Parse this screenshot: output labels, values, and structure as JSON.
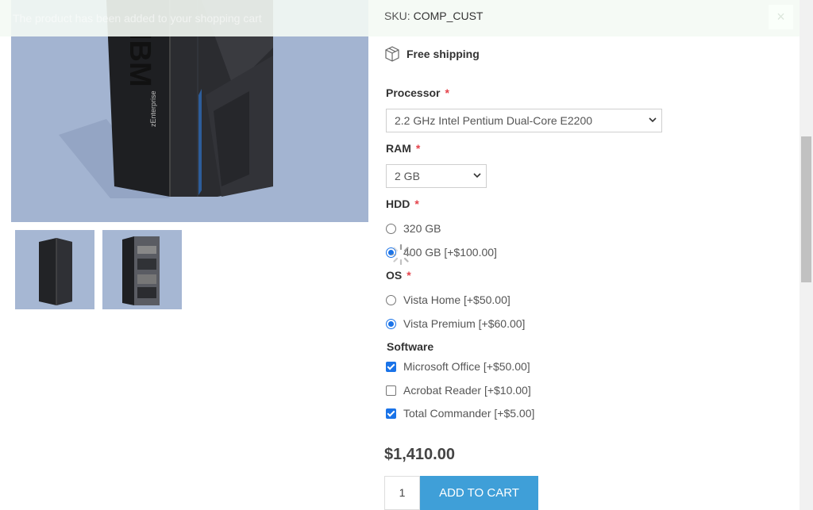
{
  "notification": {
    "text": "The product has been added to your shopping cart",
    "close_glyph": "×"
  },
  "product": {
    "sku_label": "SKU:",
    "sku_value": "COMP_CUST",
    "shipping_label": "Free shipping",
    "main_image_brand": "IBM",
    "main_image_caption": "zEnterprise"
  },
  "attributes": {
    "processor": {
      "label": "Processor",
      "required": "*",
      "selected": "2.2 GHz Intel Pentium Dual-Core E2200"
    },
    "ram": {
      "label": "RAM",
      "required": "*",
      "selected": "2 GB"
    },
    "hdd": {
      "label": "HDD",
      "required": "*",
      "options": [
        {
          "label": "320 GB",
          "checked": false
        },
        {
          "label": "400 GB [+$100.00]",
          "checked": true
        }
      ]
    },
    "os": {
      "label": "OS",
      "required": "*",
      "options": [
        {
          "label": "Vista Home [+$50.00]",
          "checked": false
        },
        {
          "label": "Vista Premium [+$60.00]",
          "checked": true
        }
      ]
    },
    "software": {
      "label": "Software",
      "options": [
        {
          "label": "Microsoft Office [+$50.00]",
          "checked": true
        },
        {
          "label": "Acrobat Reader [+$10.00]",
          "checked": false
        },
        {
          "label": "Total Commander [+$5.00]",
          "checked": true
        }
      ]
    }
  },
  "price": "$1,410.00",
  "quantity": "1",
  "add_to_cart_label": "ADD TO CART",
  "colors": {
    "accent": "#3f9fd8",
    "required": "#e4434b",
    "image_bg": "#a3b4d1"
  }
}
